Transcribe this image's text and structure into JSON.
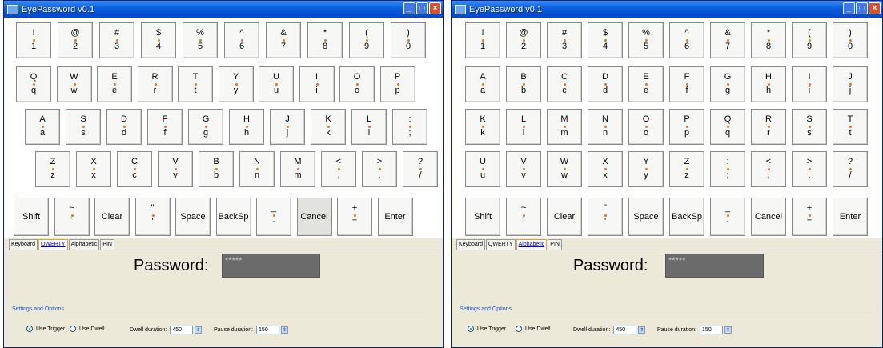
{
  "title": "EyePassword v0.1",
  "title_buttons": {
    "minimize": "_",
    "maximize": "□",
    "close": "×"
  },
  "window_left": {
    "rows": [
      [
        {
          "t": "!",
          "b": "1"
        },
        {
          "t": "@",
          "b": "2"
        },
        {
          "t": "#",
          "b": "3"
        },
        {
          "t": "$",
          "b": "4"
        },
        {
          "t": "%",
          "b": "5"
        },
        {
          "t": "^",
          "b": "6"
        },
        {
          "t": "&",
          "b": "7"
        },
        {
          "t": "*",
          "b": "8"
        },
        {
          "t": "(",
          "b": "9"
        },
        {
          "t": ")",
          "b": "0"
        }
      ],
      [
        {
          "t": "Q",
          "b": "q"
        },
        {
          "t": "W",
          "b": "w"
        },
        {
          "t": "E",
          "b": "e"
        },
        {
          "t": "R",
          "b": "r"
        },
        {
          "t": "T",
          "b": "t"
        },
        {
          "t": "Y",
          "b": "y"
        },
        {
          "t": "U",
          "b": "u"
        },
        {
          "t": "I",
          "b": "i"
        },
        {
          "t": "O",
          "b": "o"
        },
        {
          "t": "P",
          "b": "p"
        }
      ],
      [
        {
          "t": "A",
          "b": "a"
        },
        {
          "t": "S",
          "b": "s"
        },
        {
          "t": "D",
          "b": "d"
        },
        {
          "t": "F",
          "b": "f"
        },
        {
          "t": "G",
          "b": "g"
        },
        {
          "t": "H",
          "b": "h"
        },
        {
          "t": "J",
          "b": "j"
        },
        {
          "t": "K",
          "b": "k"
        },
        {
          "t": "L",
          "b": "l"
        },
        {
          "t": ":",
          "b": ";"
        }
      ],
      [
        {
          "t": "Z",
          "b": "z"
        },
        {
          "t": "X",
          "b": "x"
        },
        {
          "t": "C",
          "b": "c"
        },
        {
          "t": "V",
          "b": "v"
        },
        {
          "t": "B",
          "b": "b"
        },
        {
          "t": "N",
          "b": "n"
        },
        {
          "t": "M",
          "b": "m"
        },
        {
          "t": "<",
          "b": ","
        },
        {
          "t": ">",
          "b": "."
        },
        {
          "t": "?",
          "b": "/"
        }
      ],
      [
        {
          "w": "Shift"
        },
        {
          "t": "~",
          "b": "`"
        },
        {
          "w": "Clear"
        },
        {
          "t": "\"",
          "b": "'"
        },
        {
          "w": "Space"
        },
        {
          "w": "BackSp"
        },
        {
          "t": "_",
          "b": "-"
        },
        {
          "w": "Cancel",
          "pressed": true
        },
        {
          "t": "+",
          "b": "="
        },
        {
          "w": "Enter"
        }
      ]
    ],
    "tabs": [
      "Keyboard",
      "QWERTY",
      "Alphabetic",
      "PIN"
    ],
    "active_tab": 1,
    "password_label": "Password:",
    "password_value": "*****",
    "settings_title": "Settings and Options",
    "use_trigger": "Use Trigger",
    "use_dwell": "Use Dwell",
    "dwell_label": "Dwell duration:",
    "dwell_value": "450",
    "pause_label": "Pause duration:",
    "pause_value": "150"
  },
  "window_right": {
    "rows": [
      [
        {
          "t": "!",
          "b": "1"
        },
        {
          "t": "@",
          "b": "2"
        },
        {
          "t": "#",
          "b": "3"
        },
        {
          "t": "$",
          "b": "4"
        },
        {
          "t": "%",
          "b": "5"
        },
        {
          "t": "^",
          "b": "6"
        },
        {
          "t": "&",
          "b": "7"
        },
        {
          "t": "*",
          "b": "8"
        },
        {
          "t": "(",
          "b": "9"
        },
        {
          "t": ")",
          "b": "0"
        }
      ],
      [
        {
          "t": "A",
          "b": "a"
        },
        {
          "t": "B",
          "b": "b"
        },
        {
          "t": "C",
          "b": "c"
        },
        {
          "t": "D",
          "b": "d"
        },
        {
          "t": "E",
          "b": "e"
        },
        {
          "t": "F",
          "b": "f"
        },
        {
          "t": "G",
          "b": "g"
        },
        {
          "t": "H",
          "b": "h"
        },
        {
          "t": "I",
          "b": "i"
        },
        {
          "t": "J",
          "b": "j"
        }
      ],
      [
        {
          "t": "K",
          "b": "k"
        },
        {
          "t": "L",
          "b": "l"
        },
        {
          "t": "M",
          "b": "m"
        },
        {
          "t": "N",
          "b": "n"
        },
        {
          "t": "O",
          "b": "o"
        },
        {
          "t": "P",
          "b": "p"
        },
        {
          "t": "Q",
          "b": "q"
        },
        {
          "t": "R",
          "b": "r"
        },
        {
          "t": "S",
          "b": "s"
        },
        {
          "t": "T",
          "b": "t"
        }
      ],
      [
        {
          "t": "U",
          "b": "u"
        },
        {
          "t": "V",
          "b": "v"
        },
        {
          "t": "W",
          "b": "w"
        },
        {
          "t": "X",
          "b": "x"
        },
        {
          "t": "Y",
          "b": "y"
        },
        {
          "t": "Z",
          "b": "z"
        },
        {
          "t": ":",
          "b": ";"
        },
        {
          "t": "<",
          "b": ","
        },
        {
          "t": ">",
          "b": "."
        },
        {
          "t": "?",
          "b": "/"
        }
      ],
      [
        {
          "w": "Shift"
        },
        {
          "t": "~",
          "b": "`"
        },
        {
          "w": "Clear"
        },
        {
          "t": "\"",
          "b": "'"
        },
        {
          "w": "Space"
        },
        {
          "w": "BackSp"
        },
        {
          "t": "_",
          "b": "-"
        },
        {
          "w": "Cancel"
        },
        {
          "t": "+",
          "b": "="
        },
        {
          "w": "Enter"
        }
      ]
    ],
    "tabs": [
      "Keyboard",
      "QWERTY",
      "Alphabetic",
      "PIN"
    ],
    "active_tab": 2,
    "password_label": "Password:",
    "password_value": "*****",
    "settings_title": "Settings and Options",
    "use_trigger": "Use Trigger",
    "use_dwell": "Use Dwell",
    "dwell_label": "Dwell duration:",
    "dwell_value": "450",
    "pause_label": "Pause duration:",
    "pause_value": "150"
  }
}
